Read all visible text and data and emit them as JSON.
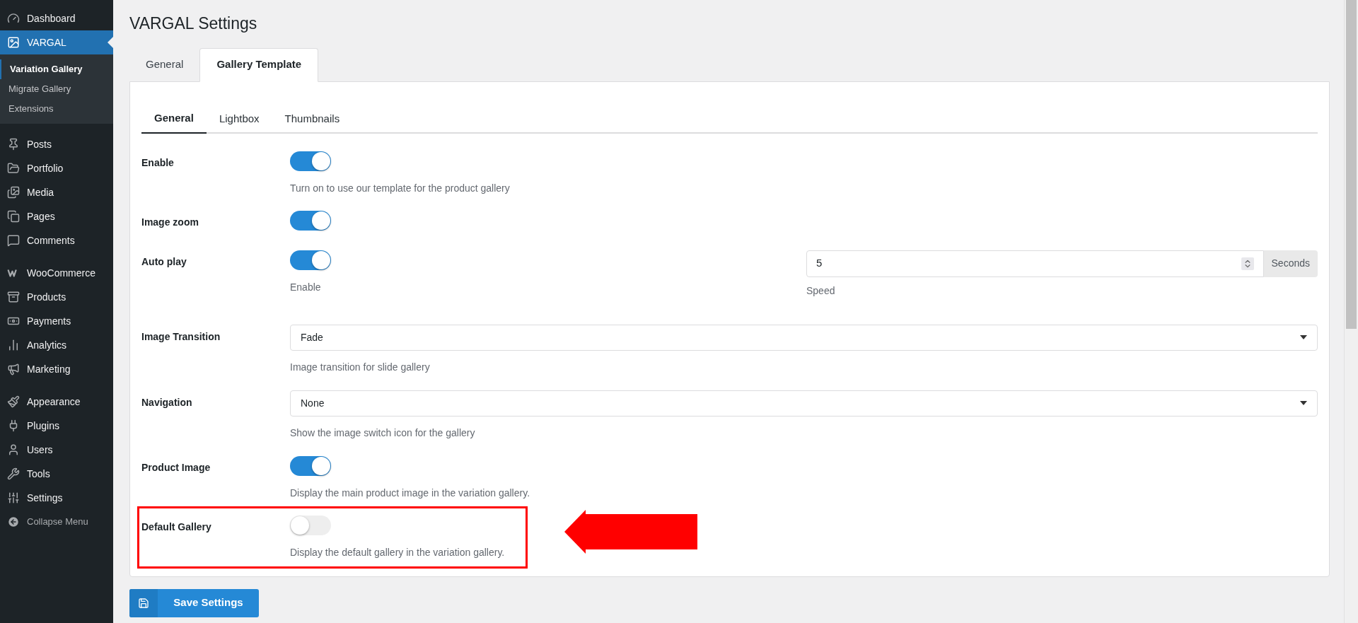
{
  "sidebar": {
    "groups": [
      [
        {
          "label": "Dashboard",
          "selected": false
        },
        {
          "label": "VARGAL",
          "selected": true,
          "children": [
            {
              "label": "Variation Gallery",
              "selected": true
            },
            {
              "label": "Migrate Gallery",
              "selected": false
            },
            {
              "label": "Extensions",
              "selected": false
            }
          ]
        }
      ],
      [
        {
          "label": "Posts",
          "selected": false
        },
        {
          "label": "Portfolio",
          "selected": false
        },
        {
          "label": "Media",
          "selected": false
        },
        {
          "label": "Pages",
          "selected": false
        },
        {
          "label": "Comments",
          "selected": false
        }
      ],
      [
        {
          "label": "WooCommerce",
          "selected": false
        },
        {
          "label": "Products",
          "selected": false
        },
        {
          "label": "Payments",
          "selected": false
        },
        {
          "label": "Analytics",
          "selected": false
        },
        {
          "label": "Marketing",
          "selected": false
        }
      ],
      [
        {
          "label": "Appearance",
          "selected": false
        },
        {
          "label": "Plugins",
          "selected": false
        },
        {
          "label": "Users",
          "selected": false
        },
        {
          "label": "Tools",
          "selected": false
        },
        {
          "label": "Settings",
          "selected": false
        }
      ]
    ],
    "collapse": "Collapse Menu"
  },
  "page_title": "VARGAL Settings",
  "tabs": [
    {
      "label": "General",
      "selected": false
    },
    {
      "label": "Gallery Template",
      "selected": true
    }
  ],
  "subtabs": [
    {
      "label": "General",
      "selected": true
    },
    {
      "label": "Lightbox",
      "selected": false
    },
    {
      "label": "Thumbnails",
      "selected": false
    }
  ],
  "settings": [
    {
      "kind": "toggle",
      "label": "Enable",
      "on": true,
      "description": "Turn on to use our template for the product gallery",
      "highlighted": false
    },
    {
      "kind": "toggle",
      "label": "Image zoom",
      "on": true,
      "highlighted": false
    },
    {
      "kind": "toggle_number",
      "label": "Auto play",
      "on": true,
      "description": "Enable",
      "value": "5",
      "unit": "Seconds",
      "field_description": "Speed",
      "highlighted": false
    },
    {
      "kind": "select",
      "label": "Image Transition",
      "value": "Fade",
      "description": "Image transition for slide gallery",
      "highlighted": false
    },
    {
      "kind": "select",
      "label": "Navigation",
      "value": "None",
      "description": "Show the image switch icon for the gallery",
      "highlighted": false
    },
    {
      "kind": "toggle",
      "label": "Product Image",
      "on": true,
      "description": "Display the main product image in the variation gallery.",
      "highlighted": false
    },
    {
      "kind": "toggle",
      "label": "Default Gallery",
      "on": false,
      "description": "Display the default gallery in the variation gallery.",
      "highlighted": true
    }
  ],
  "save_button": "Save Settings"
}
